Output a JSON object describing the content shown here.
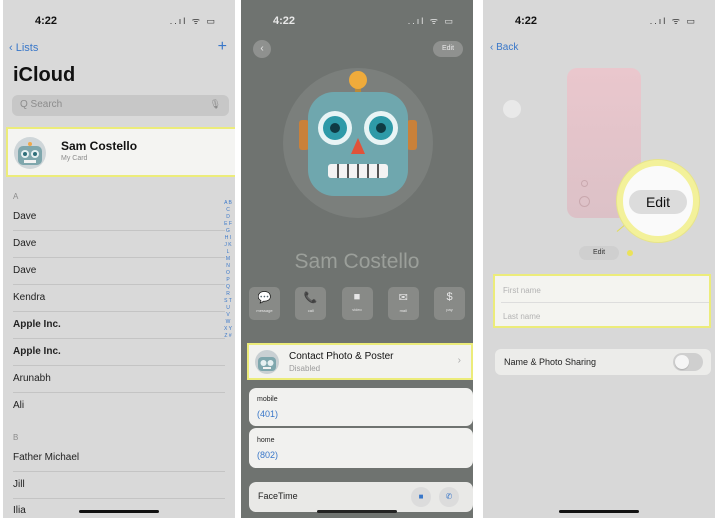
{
  "statusbar": {
    "time": "4:22",
    "icons": "..ıl ᯤ ▭"
  },
  "panel1": {
    "back_label": "‹ Lists",
    "plus_label": "+",
    "title": "iCloud",
    "search_placeholder": "Q Search",
    "mic_icon": "🎙",
    "my_card": {
      "name": "Sam Costello",
      "subtitle": "My Card"
    },
    "section_a": "A",
    "section_b": "B",
    "contacts_a": [
      "Dave",
      "Dave",
      "Dave",
      "Kendra",
      "Apple Inc.",
      "Apple Inc.",
      "Arunabh",
      "Ali"
    ],
    "contacts_b": [
      "Father Michael",
      "Jill",
      "Ilia"
    ],
    "index_letters": "A B C D E F G H I J K L M N O P Q R S T U V W X Y Z #"
  },
  "panel2": {
    "back_glyph": "‹",
    "edit_label": "Edit",
    "poster_name": "Sam Costello",
    "actions": [
      {
        "icon": "message-icon",
        "glyph": "💬",
        "label": "message"
      },
      {
        "icon": "call-icon",
        "glyph": "📞",
        "label": "call"
      },
      {
        "icon": "video-icon",
        "glyph": "■",
        "label": "video"
      },
      {
        "icon": "mail-icon",
        "glyph": "✉",
        "label": "mail"
      },
      {
        "icon": "pay-icon",
        "glyph": "$",
        "label": "pay"
      }
    ],
    "contact_photo": {
      "title": "Contact Photo & Poster",
      "status": "Disabled",
      "chevron": "›"
    },
    "mobile_label": "mobile",
    "mobile_value": "(401)",
    "home_label": "home",
    "home_value": "(802)",
    "facetime_label": "FaceTime"
  },
  "panel3": {
    "back_label": "‹ Back",
    "zoom_edit_label": "Edit",
    "small_edit_label": "Edit",
    "first_name_placeholder": "First name",
    "last_name_placeholder": "Last name",
    "sharing_label": "Name & Photo Sharing",
    "sharing_on": false
  },
  "colors": {
    "accent": "#3977c9",
    "highlight": "#ecec7a"
  }
}
